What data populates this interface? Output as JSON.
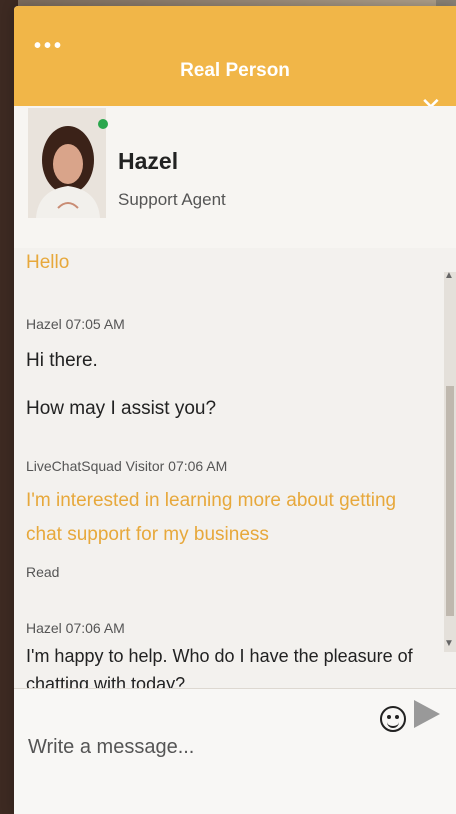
{
  "window": {
    "title": "Real Person",
    "menu_icon": "more-icon",
    "minimize_icon": "minimize-icon",
    "close_icon": "close-icon"
  },
  "agent": {
    "name": "Hazel",
    "role": "Support Agent",
    "status": "online",
    "status_color": "#2aa64d"
  },
  "colors": {
    "accent": "#f1b648",
    "visitor_text": "#e7a83b"
  },
  "messages": {
    "greeting": "Hello",
    "m1_meta": "Hazel 07:05 AM",
    "m1_line1": "Hi there.",
    "m1_line2": "How may I assist you?",
    "m2_meta": "LiveChatSquad Visitor 07:06 AM",
    "m2_line1": "I'm interested in learning more about getting",
    "m2_line2": "chat support for my business",
    "m2_status": "Read",
    "m3_meta": "Hazel 07:06 AM",
    "m3_line1": "I'm happy to help. Who do I have the pleasure of",
    "m3_line2": "chatting with today?"
  },
  "composer": {
    "placeholder": "Write a message...",
    "emoji_icon": "smiley-icon",
    "send_icon": "send-icon"
  }
}
